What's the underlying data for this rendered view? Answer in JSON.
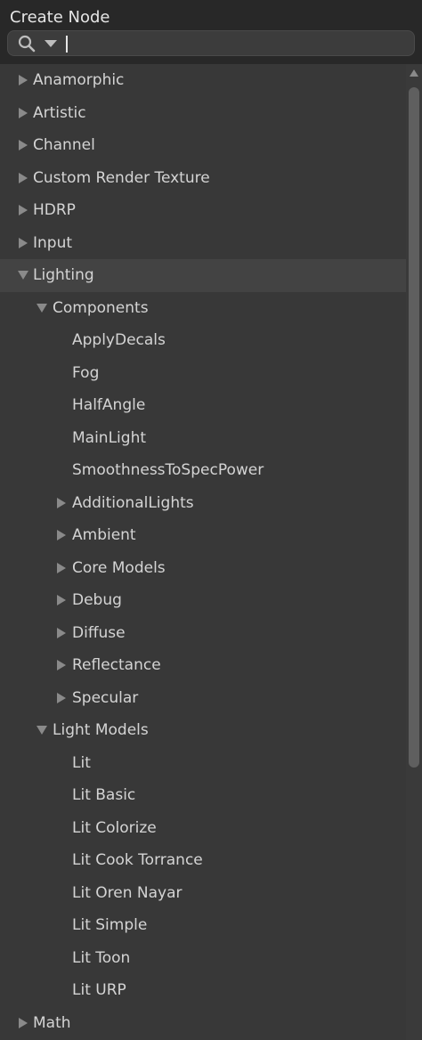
{
  "window": {
    "title": "Create Node"
  },
  "search": {
    "value": "",
    "placeholder": ""
  },
  "tree": [
    {
      "label": "Anamorphic",
      "level": 0,
      "state": "collapsed"
    },
    {
      "label": "Artistic",
      "level": 0,
      "state": "collapsed"
    },
    {
      "label": "Channel",
      "level": 0,
      "state": "collapsed"
    },
    {
      "label": "Custom Render Texture",
      "level": 0,
      "state": "collapsed"
    },
    {
      "label": "HDRP",
      "level": 0,
      "state": "collapsed"
    },
    {
      "label": "Input",
      "level": 0,
      "state": "collapsed"
    },
    {
      "label": "Lighting",
      "level": 0,
      "state": "expanded",
      "selected": true
    },
    {
      "label": "Components",
      "level": 1,
      "state": "expanded"
    },
    {
      "label": "ApplyDecals",
      "level": 2,
      "state": "leaf"
    },
    {
      "label": "Fog",
      "level": 2,
      "state": "leaf"
    },
    {
      "label": "HalfAngle",
      "level": 2,
      "state": "leaf"
    },
    {
      "label": "MainLight",
      "level": 2,
      "state": "leaf"
    },
    {
      "label": "SmoothnessToSpecPower",
      "level": 2,
      "state": "leaf"
    },
    {
      "label": "AdditionalLights",
      "level": 2,
      "state": "collapsed"
    },
    {
      "label": "Ambient",
      "level": 2,
      "state": "collapsed"
    },
    {
      "label": "Core Models",
      "level": 2,
      "state": "collapsed"
    },
    {
      "label": "Debug",
      "level": 2,
      "state": "collapsed"
    },
    {
      "label": "Diffuse",
      "level": 2,
      "state": "collapsed"
    },
    {
      "label": "Reflectance",
      "level": 2,
      "state": "collapsed"
    },
    {
      "label": "Specular",
      "level": 2,
      "state": "collapsed"
    },
    {
      "label": "Light Models",
      "level": 1,
      "state": "expanded"
    },
    {
      "label": "Lit",
      "level": 2,
      "state": "leaf"
    },
    {
      "label": "Lit Basic",
      "level": 2,
      "state": "leaf"
    },
    {
      "label": "Lit Colorize",
      "level": 2,
      "state": "leaf"
    },
    {
      "label": "Lit Cook Torrance",
      "level": 2,
      "state": "leaf"
    },
    {
      "label": "Lit Oren Nayar",
      "level": 2,
      "state": "leaf"
    },
    {
      "label": "Lit Simple",
      "level": 2,
      "state": "leaf"
    },
    {
      "label": "Lit Toon",
      "level": 2,
      "state": "leaf"
    },
    {
      "label": "Lit URP",
      "level": 2,
      "state": "leaf"
    },
    {
      "label": "Math",
      "level": 0,
      "state": "collapsed"
    }
  ],
  "colors": {
    "background": "#383838",
    "header": "#282828",
    "selected_row": "#434343",
    "text": "#d4d4d4",
    "arrow": "#8a8a8a"
  },
  "icons": {
    "search": "search-icon",
    "search_menu": "chevron-down-icon",
    "collapsed": "triangle-right-icon",
    "expanded": "triangle-down-icon",
    "scroll_up": "triangle-up-icon"
  }
}
